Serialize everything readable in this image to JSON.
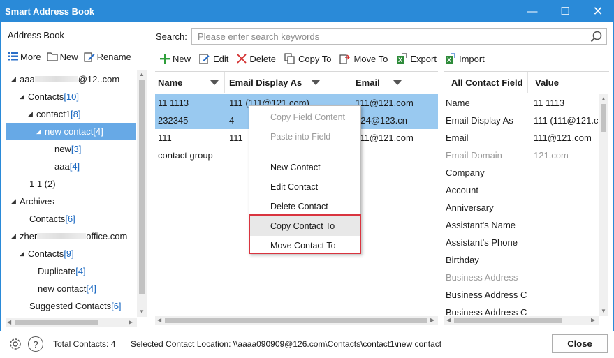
{
  "window": {
    "title": "Smart Address Book"
  },
  "left": {
    "title": "Address Book",
    "toolbar": {
      "more": "More",
      "new": "New",
      "rename": "Rename"
    },
    "tree": [
      {
        "label": "aaa",
        "suffix": "@12..com",
        "count": ""
      },
      {
        "label": "Contacts ",
        "count": "[10]"
      },
      {
        "label": "contact1 ",
        "count": "[8]"
      },
      {
        "label": "new contact ",
        "count": "[4]"
      },
      {
        "label": "new ",
        "count": "[3]"
      },
      {
        "label": "aaa ",
        "count": "[4]"
      },
      {
        "label": "1 1 (2)",
        "count": ""
      },
      {
        "label": "Archives",
        "count": ""
      },
      {
        "label": "Contacts ",
        "count": "[6]"
      },
      {
        "label": "zher",
        "suffix": "office.com",
        "count": ""
      },
      {
        "label": "Contacts ",
        "count": "[9]"
      },
      {
        "label": "Duplicate ",
        "count": "[4]"
      },
      {
        "label": "new contact ",
        "count": "[4]"
      },
      {
        "label": "Suggested Contacts ",
        "count": "[6]"
      }
    ]
  },
  "search": {
    "label": "Search:",
    "placeholder": "Please enter search keywords"
  },
  "actions": {
    "new": "New",
    "edit": "Edit",
    "delete": "Delete",
    "copy_to": "Copy To",
    "move_to": "Move To",
    "export": "Export",
    "import": "Import"
  },
  "contacts": {
    "columns": [
      "Name",
      "Email Display As",
      "Email"
    ],
    "rows": [
      {
        "name": "11 1113",
        "display": "111 (111@121.com)",
        "email": "111@121.com"
      },
      {
        "name": "232345",
        "display": "4",
        "email": "424@123.cn"
      },
      {
        "name": "111",
        "display": "111",
        "email": "111@121.com"
      },
      {
        "name": "contact group",
        "display": "",
        "email": ""
      }
    ]
  },
  "fields": {
    "columns": [
      "All Contact Field",
      "Value"
    ],
    "rows": [
      {
        "field": "Name",
        "value": "11 1113"
      },
      {
        "field": "Email Display As",
        "value": "111 (111@121.c"
      },
      {
        "field": "Email",
        "value": "111@121.com"
      },
      {
        "field": "Email Domain",
        "value": "121.com"
      },
      {
        "field": "Company",
        "value": ""
      },
      {
        "field": "Account",
        "value": ""
      },
      {
        "field": "Anniversary",
        "value": ""
      },
      {
        "field": "Assistant's Name",
        "value": ""
      },
      {
        "field": "Assistant's Phone",
        "value": ""
      },
      {
        "field": "Birthday",
        "value": ""
      },
      {
        "field": "Business Address",
        "value": ""
      },
      {
        "field": "Business Address Ci",
        "value": ""
      },
      {
        "field": "Business Address Co",
        "value": ""
      }
    ]
  },
  "context_menu": {
    "copy_field": "Copy Field Content",
    "paste_field": "Paste into Field",
    "new_contact": "New Contact",
    "edit_contact": "Edit Contact",
    "delete_contact": "Delete Contact",
    "copy_contact_to": "Copy Contact To",
    "move_contact_to": "Move Contact To"
  },
  "status": {
    "total": "Total Contacts: 4",
    "location": "Selected Contact Location: \\\\aaaa090909@126.com\\Contacts\\contact1\\new contact",
    "close": "Close"
  },
  "colors": {
    "titlebar": "#2a8ad8",
    "selection": "#67a9e6",
    "row_selection": "#99c9f0",
    "highlight_box": "#d9343f",
    "count": "#1565c0"
  },
  "icons": [
    "minimize-icon",
    "maximize-icon",
    "close-icon",
    "list-icon",
    "folder-icon",
    "rename-icon",
    "search-icon",
    "plus-icon",
    "edit-icon",
    "delete-icon",
    "copy-icon",
    "move-icon",
    "export-icon",
    "import-icon",
    "gear-icon",
    "help-icon"
  ]
}
